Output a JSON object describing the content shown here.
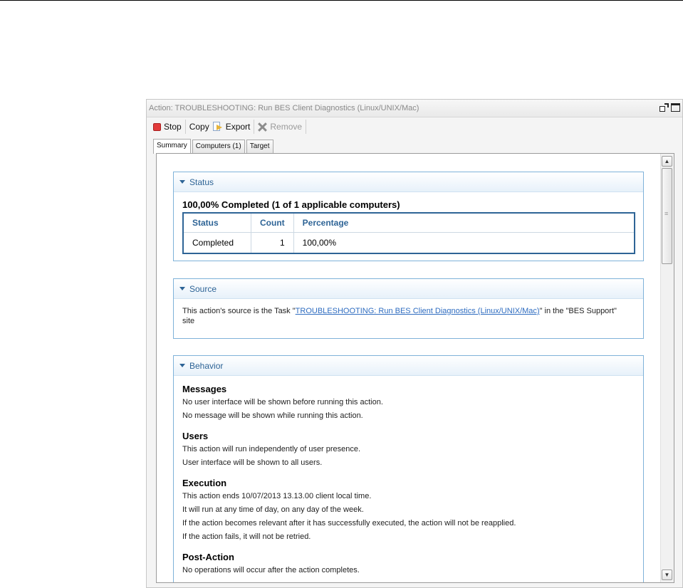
{
  "window": {
    "title": "Action: TROUBLESHOOTING: Run BES Client Diagnostics (Linux/UNIX/Mac)"
  },
  "toolbar": {
    "stop_label": "Stop",
    "copy_label": "Copy",
    "export_label": "Export",
    "remove_label": "Remove"
  },
  "tabs": [
    {
      "label": "Summary",
      "active": true
    },
    {
      "label": "Computers (1)",
      "active": false
    },
    {
      "label": "Target",
      "active": false
    }
  ],
  "status": {
    "heading": "Status",
    "completed_text": "100,00% Completed (1 of 1 applicable computers)",
    "columns": [
      "Status",
      "Count",
      "Percentage"
    ],
    "rows": [
      {
        "status": "Completed",
        "count": "1",
        "percentage": "100,00%"
      }
    ]
  },
  "source": {
    "heading": "Source",
    "text_before": "This action's source is the Task \"",
    "link_text": "TROUBLESHOOTING: Run BES Client Diagnostics (Linux/UNIX/Mac)",
    "text_after": "\" in the \"BES Support\" site"
  },
  "behavior": {
    "heading": "Behavior",
    "groups": [
      {
        "title": "Messages",
        "lines": [
          "No user interface will be shown before running this action.",
          "No message will be shown while running this action."
        ]
      },
      {
        "title": "Users",
        "lines": [
          "This action will run independently of user presence.",
          "User interface will be shown to all users."
        ]
      },
      {
        "title": "Execution",
        "lines": [
          "This action ends 10/07/2013 13.13.00 client local time.",
          "It will run at any time of day, on any day of the week.",
          "If the action becomes relevant after it has successfully executed, the action will not be reapplied.",
          "If the action fails, it will not be retried."
        ]
      },
      {
        "title": "Post-Action",
        "lines": [
          "No operations will occur after the action completes."
        ]
      }
    ]
  },
  "colors": {
    "accent": "#2e6496",
    "link": "#2e6cc0",
    "stop": "#e23b3b"
  }
}
